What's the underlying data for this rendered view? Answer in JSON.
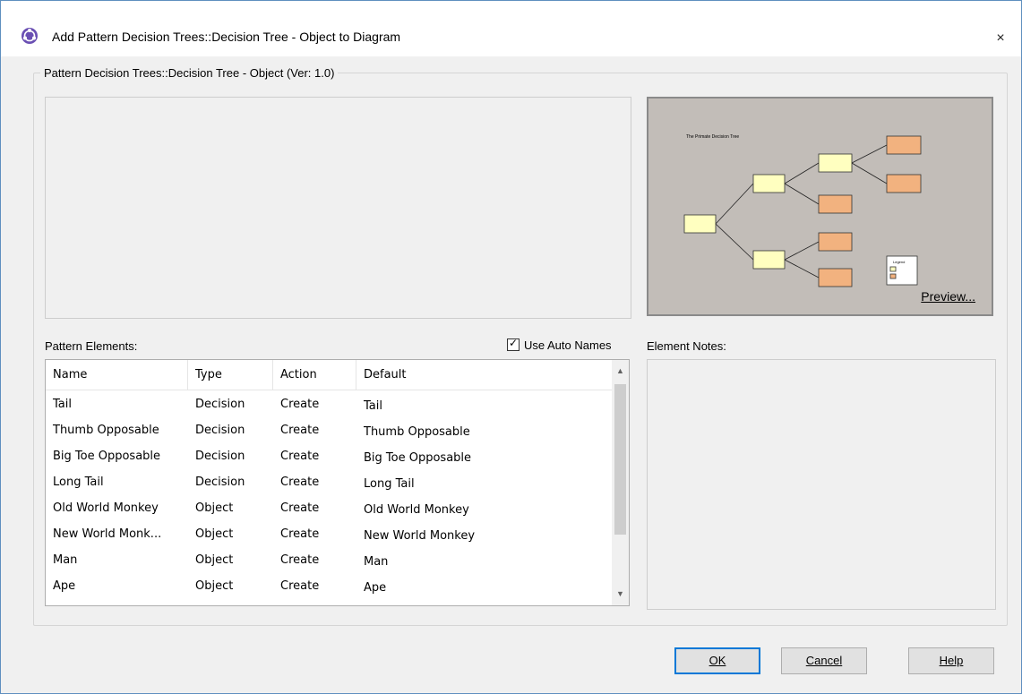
{
  "window": {
    "title": "Add Pattern Decision Trees::Decision Tree - Object to Diagram",
    "close_glyph": "×"
  },
  "group": {
    "legend": "Pattern Decision Trees::Decision Tree - Object (Ver: 1.0)"
  },
  "preview": {
    "link_label": "Preview...",
    "diagram_title": "The Primate Decision Tree",
    "legend_title": "Legend",
    "bg_color": "#c2bdb8",
    "decision_color": "#ffffc0",
    "object_color": "#f2b27f"
  },
  "pattern_elements": {
    "label": "Pattern Elements:",
    "auto_names_label": "Use Auto Names",
    "auto_names_checked": true,
    "columns": [
      "Name",
      "Type",
      "Action",
      "Default"
    ],
    "rows": [
      {
        "name": "Tail",
        "type": "Decision",
        "action": "Create",
        "default": "Tail"
      },
      {
        "name": "Thumb Opposable",
        "type": "Decision",
        "action": "Create",
        "default": "Thumb Opposable"
      },
      {
        "name": "Big Toe Opposable",
        "type": "Decision",
        "action": "Create",
        "default": "Big Toe Opposable"
      },
      {
        "name": "Long Tail",
        "type": "Decision",
        "action": "Create",
        "default": "Long Tail"
      },
      {
        "name": "Old World Monkey",
        "type": "Object",
        "action": "Create",
        "default": "Old World Monkey"
      },
      {
        "name": "New World Monk...",
        "type": "Object",
        "action": "Create",
        "default": "New World Monkey"
      },
      {
        "name": "Man",
        "type": "Object",
        "action": "Create",
        "default": "Man"
      },
      {
        "name": "Ape",
        "type": "Object",
        "action": "Create",
        "default": "Ape"
      }
    ]
  },
  "element_notes": {
    "label": "Element Notes:"
  },
  "buttons": {
    "ok": "OK",
    "cancel": "Cancel",
    "help": "Help"
  }
}
